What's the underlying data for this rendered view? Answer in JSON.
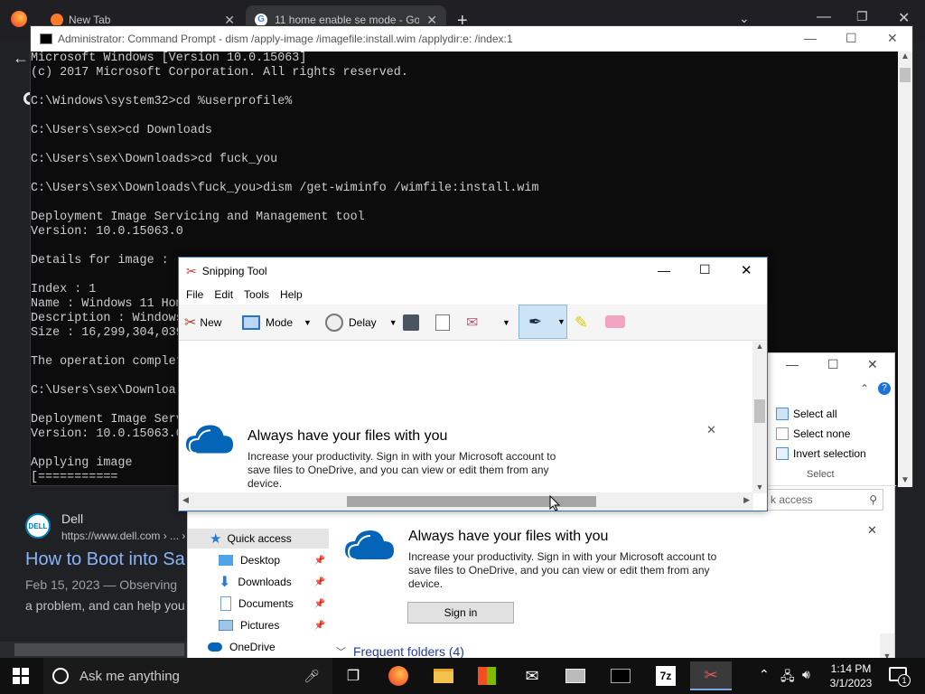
{
  "browser": {
    "tabs": [
      {
        "label": "New Tab"
      },
      {
        "label": "11 home enable se mode - Goo"
      }
    ],
    "results": [
      {
        "site": "Dell",
        "url": "https://www.dell.com › ... ›",
        "title": "How to Boot into Sa",
        "snippet_date": "Feb 15, 2023 — Observing",
        "snippet": "a problem, and can help you"
      }
    ]
  },
  "cmd": {
    "title": "Administrator: Command Prompt - dism  /apply-image /imagefile:install.wim /applydir:e: /index:1",
    "lines": [
      "Microsoft Windows [Version 10.0.15063]",
      "(c) 2017 Microsoft Corporation. All rights reserved.",
      "",
      "C:\\Windows\\system32>cd %userprofile%",
      "",
      "C:\\Users\\sex>cd Downloads",
      "",
      "C:\\Users\\sex\\Downloads>cd fuck_you",
      "",
      "C:\\Users\\sex\\Downloads\\fuck_you>dism /get-wiminfo /wimfile:install.wim",
      "",
      "Deployment Image Servicing and Management tool",
      "Version: 10.0.15063.0",
      "",
      "Details for image : ",
      "",
      "Index : 1",
      "Name : Windows 11 Hom",
      "Description : Windows",
      "Size : 16,299,304,039",
      "",
      "The operation complet",
      "",
      "C:\\Users\\sex\\Downloa",
      "",
      "Deployment Image Serv",
      "Version: 10.0.15063.0",
      "",
      "Applying image",
      "[==========="
    ]
  },
  "snipping_tool": {
    "title": "Snipping Tool",
    "menu": [
      "File",
      "Edit",
      "Tools",
      "Help"
    ],
    "toolbar": {
      "new": "New",
      "mode": "Mode",
      "delay": "Delay"
    },
    "banner": {
      "title": "Always have your files with you",
      "body": "Increase your productivity. Sign in with your Microsoft account to save files to OneDrive, and you can view or edit them from any device."
    }
  },
  "explorer": {
    "ribbon": {
      "select_all": "Select all",
      "select_none": "Select none",
      "invert": "Invert selection",
      "group": "Select"
    },
    "search_placeholder": "k access",
    "nav": [
      {
        "label": "Quick access"
      },
      {
        "label": "Desktop"
      },
      {
        "label": "Downloads"
      },
      {
        "label": "Documents"
      },
      {
        "label": "Pictures"
      },
      {
        "label": "OneDrive"
      }
    ],
    "banner": {
      "title": "Always have your files with you",
      "body": "Increase your productivity. Sign in with your Microsoft account to save files to OneDrive, and you can view or edit them from any device.",
      "sign_in": "Sign in"
    },
    "frequent": "Frequent folders (4)"
  },
  "taskbar": {
    "search_placeholder": "Ask me anything",
    "time": "1:14 PM",
    "date": "3/1/2023",
    "notification_count": "1"
  },
  "colors": {
    "accent": "#2a74c8",
    "onedrive": "#0364b8",
    "taskbar": "#101010"
  }
}
